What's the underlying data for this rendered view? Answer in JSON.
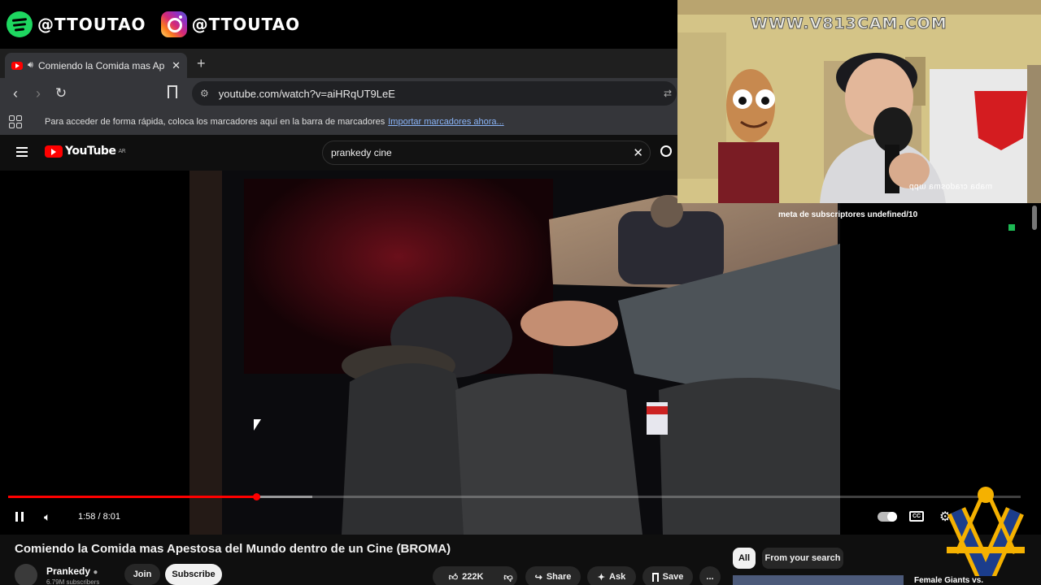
{
  "social": {
    "spotify_handle": "@TTOUTAO",
    "instagram_handle": "@TTOUTAO"
  },
  "browser": {
    "tab_title": "Comiendo la Comida mas Ap",
    "new_tab": "+",
    "url": "youtube.com/watch?v=aiHRqUT9LeE",
    "bookmarks_text": "Para acceder de forma rápida, coloca los marcadores aquí en la barra de marcadores",
    "bookmarks_link": "Importar marcadores ahora..."
  },
  "youtube": {
    "logo_text": "YouTube",
    "logo_region": "AR",
    "search_value": "prankedy cine"
  },
  "player": {
    "time": "1:58 / 8:01",
    "played_fraction": 0.245,
    "buffered_fraction": 0.3
  },
  "overlay": {
    "cam_watermark": "WWW.V813CAM.COM",
    "cam_mirror_text": "ddm ɐɯsopɐɹɔ ɐqɐɯ",
    "subscriber_goal": "meta de subscriptores undefined/10"
  },
  "video_info": {
    "title": "Comiendo la Comida mas Apestosa del Mundo dentro de un Cine (BROMA)",
    "channel": "Prankedy",
    "subscribers": "6.79M subscribers",
    "join": "Join",
    "subscribe": "Subscribe",
    "likes": "222K",
    "share": "Share",
    "ask": "Ask",
    "save": "Save",
    "more": "..."
  },
  "sidebar": {
    "chip_all": "All",
    "chip_search": "From your search",
    "next_title": "Female Giants vs."
  },
  "colors": {
    "youtube_red": "#ff0000",
    "spotify_green": "#1ed760",
    "link_blue": "#8ab4f8"
  }
}
